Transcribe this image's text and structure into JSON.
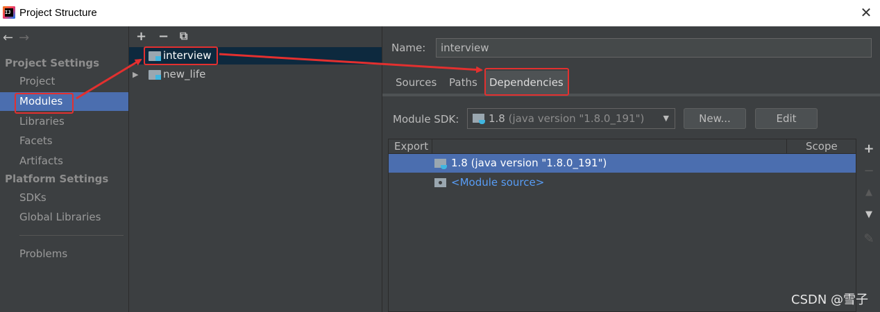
{
  "window": {
    "title": "Project Structure",
    "app_icon_text": "IJ",
    "close_glyph": "✕"
  },
  "nav": {
    "back": "←",
    "forward": "→",
    "sections": [
      {
        "heading": "Project Settings",
        "items": [
          "Project",
          "Modules",
          "Libraries",
          "Facets",
          "Artifacts"
        ]
      },
      {
        "heading": "Platform Settings",
        "items": [
          "SDKs",
          "Global Libraries"
        ]
      }
    ],
    "extra": "Problems",
    "selected": "Modules"
  },
  "module_toolbar": {
    "add": "+",
    "remove": "−",
    "copy": "⧉"
  },
  "modules": [
    {
      "name": "interview",
      "selected": true
    },
    {
      "name": "new_life",
      "selected": false,
      "expand": "▶"
    }
  ],
  "detail": {
    "name_label": "Name:",
    "name_value": "interview",
    "tabs": [
      "Sources",
      "Paths",
      "Dependencies"
    ],
    "active_tab": "Dependencies",
    "sdk_label": "Module SDK:",
    "sdk_version": "1.8",
    "sdk_detail": "(java version \"1.8.0_191\")",
    "sdk_dropdown_arrow": "▼",
    "new_button": "New...",
    "edit_button": "Edit",
    "table": {
      "columns": [
        "Export",
        "Scope"
      ],
      "rows": [
        {
          "name": "1.8 (java version \"1.8.0_191\")",
          "selected": true,
          "kind": "sdk"
        },
        {
          "name": "<Module source>",
          "selected": false,
          "kind": "source"
        }
      ]
    },
    "side_tools": {
      "add": "+",
      "remove": "−",
      "up": "▲",
      "down": "▼",
      "edit": "✎"
    }
  },
  "watermark": "CSDN @雪子",
  "colors": {
    "selection": "#4b6eaf",
    "tree_selection": "#0d293e",
    "annotation_red": "#e3302f",
    "link": "#589df6"
  }
}
